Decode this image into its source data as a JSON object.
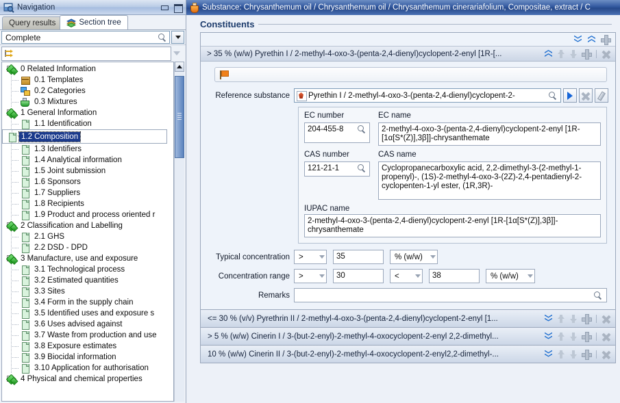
{
  "nav": {
    "title": "Navigation",
    "window_buttons": {
      "minimize": "minimize",
      "maximize": "maximize"
    },
    "tabs": [
      {
        "label": "Query results",
        "active": false
      },
      {
        "label": "Section tree",
        "active": true
      }
    ],
    "filter_value": "Complete",
    "tree": [
      {
        "label": "0 Related Information",
        "level": 0,
        "icon": "diamond",
        "selected": false
      },
      {
        "label": "0.1 Templates",
        "level": 1,
        "icon": "box",
        "selected": false
      },
      {
        "label": "0.2 Categories",
        "level": 1,
        "icon": "cubes",
        "selected": false
      },
      {
        "label": "0.3 Mixtures",
        "level": 1,
        "icon": "flask",
        "selected": false
      },
      {
        "label": "1 General Information",
        "level": 0,
        "icon": "diamond",
        "selected": false
      },
      {
        "label": "1.1 Identification",
        "level": 1,
        "icon": "page",
        "selected": false
      },
      {
        "label": "1.2 Composition",
        "level": 1,
        "icon": "page",
        "selected": true
      },
      {
        "label": "1.3 Identifiers",
        "level": 1,
        "icon": "page",
        "selected": false
      },
      {
        "label": "1.4 Analytical information",
        "level": 1,
        "icon": "page",
        "selected": false
      },
      {
        "label": "1.5 Joint submission",
        "level": 1,
        "icon": "page",
        "selected": false
      },
      {
        "label": "1.6 Sponsors",
        "level": 1,
        "icon": "page",
        "selected": false
      },
      {
        "label": "1.7 Suppliers",
        "level": 1,
        "icon": "page",
        "selected": false
      },
      {
        "label": "1.8 Recipients",
        "level": 1,
        "icon": "page",
        "selected": false
      },
      {
        "label": "1.9 Product and process oriented r",
        "level": 1,
        "icon": "page",
        "selected": false
      },
      {
        "label": "2 Classification and Labelling",
        "level": 0,
        "icon": "diamond",
        "selected": false
      },
      {
        "label": "2.1 GHS",
        "level": 1,
        "icon": "page",
        "selected": false
      },
      {
        "label": "2.2 DSD - DPD",
        "level": 1,
        "icon": "page",
        "selected": false
      },
      {
        "label": "3 Manufacture, use and exposure",
        "level": 0,
        "icon": "diamond",
        "selected": false
      },
      {
        "label": "3.1 Technological process",
        "level": 1,
        "icon": "page",
        "selected": false
      },
      {
        "label": "3.2 Estimated quantities",
        "level": 1,
        "icon": "page",
        "selected": false
      },
      {
        "label": "3.3 Sites",
        "level": 1,
        "icon": "page",
        "selected": false
      },
      {
        "label": "3.4 Form in the supply chain",
        "level": 1,
        "icon": "page",
        "selected": false
      },
      {
        "label": "3.5 Identified uses and exposure s",
        "level": 1,
        "icon": "page",
        "selected": false
      },
      {
        "label": "3.6 Uses advised against",
        "level": 1,
        "icon": "page",
        "selected": false
      },
      {
        "label": "3.7 Waste from production and use",
        "level": 1,
        "icon": "page",
        "selected": false
      },
      {
        "label": "3.8 Exposure estimates",
        "level": 1,
        "icon": "page",
        "selected": false
      },
      {
        "label": "3.9 Biocidal information",
        "level": 1,
        "icon": "page",
        "selected": false
      },
      {
        "label": "3.10 Application for authorisation",
        "level": 1,
        "icon": "page",
        "selected": false
      },
      {
        "label": "4 Physical and chemical properties",
        "level": 0,
        "icon": "diamond",
        "selected": false
      }
    ]
  },
  "substance_bar": {
    "title": "Substance: Chrysanthemum oil / Chrysanthemum oil / Chrysanthemum cinerariafolium, Compositae, extract / C"
  },
  "main": {
    "section_title": "Constituents",
    "expanded_item": {
      "header": "> 35 % (w/w) Pyrethin I / 2-methyl-4-oxo-3-(penta-2,4-dienyl)cyclopent-2-enyl [1R-[...",
      "reference_substance_label": "Reference substance",
      "reference_substance_value": "Pyrethin I / 2-methyl-4-oxo-3-(penta-2,4-dienyl)cyclopent-2-",
      "ec_number_label": "EC number",
      "ec_number_value": "204-455-8",
      "ec_name_label": "EC name",
      "ec_name_value": "2-methyl-4-oxo-3-(penta-2,4-dienyl)cyclopent-2-enyl [1R-[1α[S*(Z)],3β]]-chrysanthemate",
      "cas_number_label": "CAS number",
      "cas_number_value": "121-21-1",
      "cas_name_label": "CAS name",
      "cas_name_value": "Cyclopropanecarboxylic acid, 2,2-dimethyl-3-(2-methyl-1-propenyl)-, (1S)-2-methyl-4-oxo-3-(2Z)-2,4-pentadienyl-2-cyclopenten-1-yl ester, (1R,3R)-",
      "iupac_name_label": "IUPAC name",
      "iupac_name_value": "2-methyl-4-oxo-3-(penta-2,4-dienyl)cyclopent-2-enyl [1R-[1α[S*(Z)],3β]]-chrysanthemate",
      "typical_concentration_label": "Typical concentration",
      "typical_concentration_operator": ">",
      "typical_concentration_value": "35",
      "typical_concentration_unit": "% (w/w)",
      "concentration_range_label": "Concentration range",
      "concentration_range_lower_operator": ">",
      "concentration_range_lower_value": "30",
      "concentration_range_upper_operator": "<",
      "concentration_range_upper_value": "38",
      "concentration_range_unit": "% (w/w)",
      "remarks_label": "Remarks",
      "remarks_value": ""
    },
    "collapsed_items": [
      {
        "header": "<= 30 % (v/v) Pyrethrin II / 2-methyl-4-oxo-3-(penta-2,4-dienyl)cyclopent-2-enyl [1..."
      },
      {
        "header": "> 5 % (w/w) Cinerin I / 3-(but-2-enyl)-2-methyl-4-oxocyclopent-2-enyl 2,2-dimethyl..."
      },
      {
        "header": "10 % (w/w) Cinerin II / 3-(but-2-enyl)-2-methyl-4-oxocyclopent-2-enyl2,2-dimethyl-..."
      }
    ]
  },
  "colors": {
    "accent_blue": "#1f6fd0",
    "title_bar": "#31589f",
    "selection": "#1b3a8c",
    "panel_bg": "#eef3fa"
  }
}
